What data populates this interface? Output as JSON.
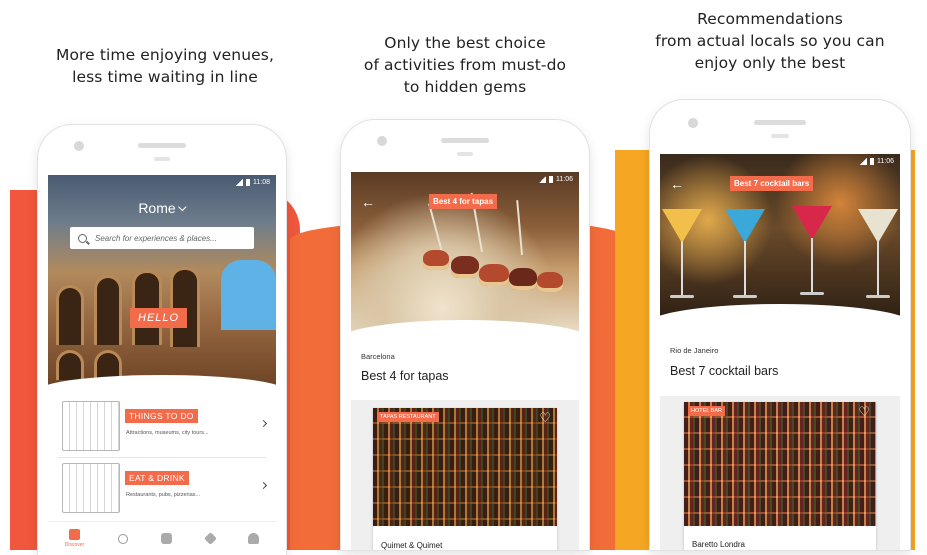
{
  "colors": {
    "accent": "#f26b4a",
    "band_left": "#f0573c",
    "band_mid": "#f26c3a",
    "band_right": "#f5a623"
  },
  "captions": [
    {
      "line1": "More time enjoying venues,",
      "line2": "less time waiting in line"
    },
    {
      "line1": "Only the best choice",
      "line2": "of activities from must-do",
      "line3": "to hidden gems"
    },
    {
      "line1": "Recommendations",
      "line2": "from actual locals so you can",
      "line3": "enjoy only the best"
    }
  ],
  "screen1": {
    "time": "11:08",
    "city": "Rome",
    "search_placeholder": "Search for experiences & places...",
    "hero_label": "HELLO",
    "categories": [
      {
        "label": "THINGS TO DO",
        "sub": "Attractions, museums, city tours..."
      },
      {
        "label": "EAT & DRINK",
        "sub": "Restaurants, pubs, pizzerias..."
      }
    ],
    "tabs": [
      {
        "label": "Discover",
        "icon": "discover-icon"
      },
      {
        "label": "",
        "icon": "search-icon"
      },
      {
        "label": "",
        "icon": "chat-icon"
      },
      {
        "label": "",
        "icon": "tag-icon"
      },
      {
        "label": "",
        "icon": "profile-icon"
      }
    ]
  },
  "screen2": {
    "time": "11:06",
    "header_tag": "Best 4 for tapas",
    "city": "Barcelona",
    "title": "Best 4 for tapas",
    "card": {
      "badge": "TAPAS RESTAURANT",
      "name": "Quimet & Quimet"
    }
  },
  "screen3": {
    "time": "11:06",
    "header_tag": "Best 7 cocktail bars",
    "city": "Rio de Janeiro",
    "title": "Best 7 cocktail bars",
    "card": {
      "badge": "HOTEL BAR",
      "name": "Baretto Londra"
    }
  }
}
